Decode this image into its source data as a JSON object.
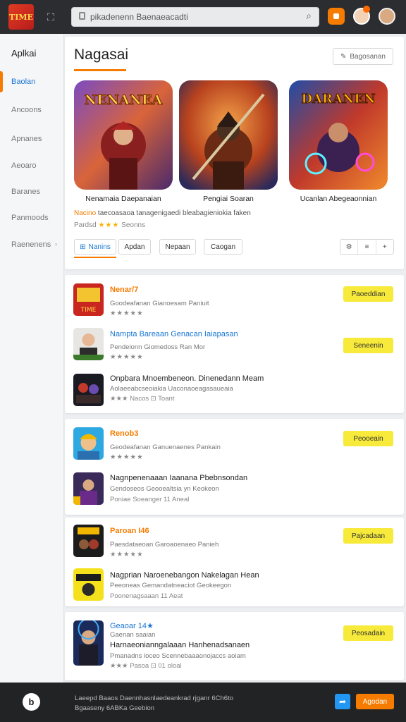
{
  "topbar": {
    "logo_text": "TIME",
    "search_value": "pikadenenn Baenaeacadti",
    "icons": [
      "grid-icon",
      "lock-icon",
      "search-icon",
      "extension-icon",
      "avatar",
      "avatar"
    ]
  },
  "sidebar": {
    "title": "Aplkai",
    "items": [
      {
        "label": "Baolan",
        "active": true
      },
      {
        "label": "Ancoons"
      },
      {
        "label": "Apnanes"
      },
      {
        "label": "Aeoaro"
      },
      {
        "label": "Baranes"
      },
      {
        "label": "Panmoods"
      },
      {
        "label": "Raenenens"
      }
    ]
  },
  "featured": {
    "title": "Nagasai",
    "action_label": "Bagosanan",
    "games": [
      {
        "caption": "Nenamaia Daepanaian",
        "art_title": "NENANEA"
      },
      {
        "caption": "Pengiai Soaran",
        "art_title": ""
      },
      {
        "caption": "Ucanlan Abegeaonnian",
        "art_title": "DARANEN"
      }
    ],
    "desc_highlight": "Nacino",
    "desc_text": "taecoasaoa tanagenigaedi bleabagieniokia faken",
    "rating_label": "Pardsd",
    "rating_stars": "★★★",
    "rating_text": "Seonns",
    "chips": [
      {
        "label": "Nanins",
        "active": true
      },
      {
        "label": "Apdan"
      },
      {
        "label": "Nepaan"
      },
      {
        "label": "Caogan"
      }
    ]
  },
  "lists": [
    {
      "rows": [
        {
          "title": "Nenar/7",
          "style": "orange",
          "sub": "Goodeafanan Gianoesam Paniuit",
          "stars": "★★★★★",
          "star_color": "green",
          "button": "Paoeddian"
        },
        {
          "title": "Nampta Bareaan Genacan Iaiapasan",
          "style": "blue",
          "sub": "Pendeionn Giomedoss Ran Mor",
          "stars": "★★★★★",
          "star_color": "yellow",
          "button": "Seneenin"
        },
        {
          "title": "Onpbara Mnoembeneon. Dinenedann Meam",
          "style": "dark",
          "sub": "Aolaeeabcseoiakia Uaconaoeagasaueaia",
          "meta": "★★★  Nacos   ⊡ Toant"
        }
      ]
    },
    {
      "rows": [
        {
          "title": "Renob3",
          "style": "orange",
          "sub": "Geodeafanan Ganuenaenes Pankain",
          "stars": "★★★★★",
          "star_color": "yellow",
          "button": "Peooeain"
        },
        {
          "title": "Nagnpenenaaan Iaanana Pbebnsondan",
          "style": "dark",
          "sub": "Gendoseos Geooealtsia yn Keokeon",
          "meta": "Poniae Soeanger 11 Aneal"
        }
      ]
    },
    {
      "rows": [
        {
          "title": "Paroan I46",
          "style": "orange",
          "sub": "Paesdataeoan Garoaoenaeo Panieh",
          "stars": "★★★★★",
          "star_color": "yellow",
          "button": "Pajcadaan"
        },
        {
          "title": "Nagprian Naroenebangon Nakelagan Hean",
          "style": "dark",
          "sub": "Peeoneas Gemandatneaciot Geokeegon",
          "meta": "Poonenagsaaan  11  Aeat"
        }
      ]
    },
    {
      "rows": [
        {
          "title": "Geaoar 14★",
          "style": "blue",
          "sub": "Gaenan saaian",
          "button": "Peosadain"
        },
        {
          "title": "Harnaeonianngalaaan Hanhenadsanaen",
          "style": "dark",
          "sub": "Pmanadns loceo Scennebaaaonojaccs aoiam",
          "meta": "★★★  Pasoa    ⊡ 01 oloal"
        }
      ]
    }
  ],
  "bottombar": {
    "circle_label": "b",
    "line1": "Laeepd Baaos Daennhasnlaedeankrad rjganr 6Ch6to",
    "line2": "Bgaaseny 6ABKa Geebion",
    "share_icon": "share-icon",
    "button": "Agodan"
  },
  "colors": {
    "accent": "#f57c00",
    "link": "#1976d2",
    "yellow_button": "#f7ea3a",
    "dark_bar": "#2b2d31"
  }
}
